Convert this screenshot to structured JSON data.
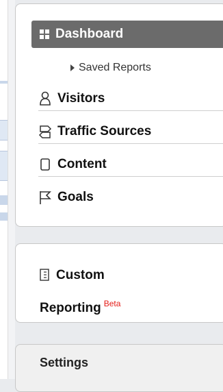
{
  "nav": {
    "dashboard_label": "Dashboard",
    "saved_reports_label": "Saved Reports",
    "items": [
      {
        "label": "Visitors",
        "icon": "person-icon"
      },
      {
        "label": "Traffic Sources",
        "icon": "signpost-icon"
      },
      {
        "label": "Content",
        "icon": "page-icon"
      },
      {
        "label": "Goals",
        "icon": "flag-icon"
      }
    ]
  },
  "custom": {
    "line1": "Custom",
    "line2": "Reporting",
    "badge": "Beta"
  },
  "settings": {
    "label": "Settings"
  },
  "colors": {
    "dashboard_bg": "#6b6b6b",
    "beta": "#e41b17"
  }
}
